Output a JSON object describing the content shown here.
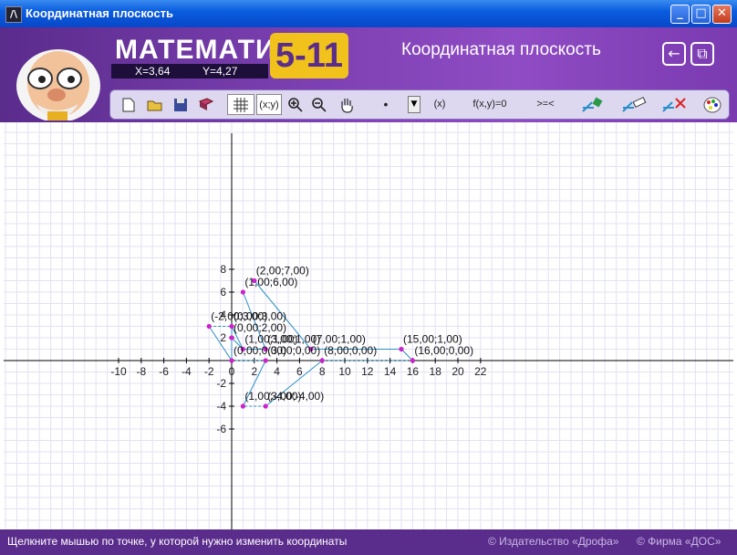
{
  "window": {
    "title": "Координатная плоскость",
    "app_icon_glyph": "/\\",
    "minimize_glyph": "_",
    "maximize_glyph": "□",
    "close_glyph": "✕"
  },
  "header": {
    "brand_word": "МАТЕМАТИКА",
    "brand_grade": "5-11",
    "cursor_x": "X=3,64",
    "cursor_y": "Y=4,27",
    "module_title": "Координатная плоскость",
    "back_glyph": "←",
    "window_glyph": "⧉"
  },
  "toolbar": {
    "point_mode_label": "(x;y)",
    "function_label": "f(x,y)=0",
    "inequality_label": ">=<",
    "dropdown_value": "•",
    "dropdown_arrow": "▼",
    "coord_input_label": "(x)"
  },
  "status": {
    "hint": "Щелкните мышью по точке, у которой нужно изменить координаты",
    "publisher": "© Издательство «Дрофа»",
    "developer": "© Фирма «ДОС»"
  },
  "colors": {
    "accent": "#5a2c8c",
    "point": "#cc22cc",
    "segment": "#2a8fc8",
    "grid": "#e3e1f3",
    "axis": "#000000"
  },
  "chart_data": {
    "type": "scatter",
    "x_range": [
      -10,
      22
    ],
    "y_range": [
      -7,
      9
    ],
    "x_ticks": [
      "-10",
      "-8",
      "-6",
      "-4",
      "-2",
      "0",
      "2",
      "4",
      "6",
      "8",
      "10",
      "12",
      "14",
      "16",
      "18",
      "20",
      "22"
    ],
    "y_ticks": [
      "-6",
      "-4",
      "-2",
      "2",
      "4",
      "6",
      "8"
    ],
    "grid": true,
    "points": [
      {
        "x": 2,
        "y": 7,
        "label": "(2,00;7,00)"
      },
      {
        "x": 1,
        "y": 6,
        "label": "(1,00;6,00)"
      },
      {
        "x": -2,
        "y": 3,
        "label": "(-2,00;3,00)"
      },
      {
        "x": 0,
        "y": 3,
        "label": "(0,00;3,00)"
      },
      {
        "x": 0,
        "y": 2,
        "label": "(0,00;2,00)"
      },
      {
        "x": 1,
        "y": 1,
        "label": "(1,00;1,00)"
      },
      {
        "x": 3,
        "y": 1,
        "label": "(3,00;1,00)"
      },
      {
        "x": 7,
        "y": 1,
        "label": "(7,00;1,00)"
      },
      {
        "x": 15,
        "y": 1,
        "label": "(15,00;1,00)"
      },
      {
        "x": 0,
        "y": 0,
        "label": "(0,00;0,00)"
      },
      {
        "x": 3,
        "y": 0,
        "label": "(3,00;0,00)"
      },
      {
        "x": 8,
        "y": 0,
        "label": "(8,00;0,00)"
      },
      {
        "x": 16,
        "y": 0,
        "label": "(16,00;0,00)"
      },
      {
        "x": 1,
        "y": -4,
        "label": "(1,00;-4,00)"
      },
      {
        "x": 3,
        "y": -4,
        "label": "(3,00;-4,00)"
      }
    ],
    "segments": [
      {
        "from": [
          2,
          7
        ],
        "to": [
          7,
          1
        ],
        "dashed": false
      },
      {
        "from": [
          7,
          1
        ],
        "to": [
          15,
          1
        ],
        "dashed": false
      },
      {
        "from": [
          15,
          1
        ],
        "to": [
          16,
          0
        ],
        "dashed": false
      },
      {
        "from": [
          16,
          0
        ],
        "to": [
          8,
          0
        ],
        "dashed": true
      },
      {
        "from": [
          8,
          0
        ],
        "to": [
          3,
          -4
        ],
        "dashed": false
      },
      {
        "from": [
          3,
          -4
        ],
        "to": [
          1,
          -4
        ],
        "dashed": true
      },
      {
        "from": [
          1,
          -4
        ],
        "to": [
          3,
          0
        ],
        "dashed": false
      },
      {
        "from": [
          3,
          0
        ],
        "to": [
          0,
          0
        ],
        "dashed": true
      },
      {
        "from": [
          0,
          0
        ],
        "to": [
          -2,
          3
        ],
        "dashed": false
      },
      {
        "from": [
          -2,
          3
        ],
        "to": [
          0,
          3
        ],
        "dashed": true
      },
      {
        "from": [
          0,
          3
        ],
        "to": [
          1,
          1
        ],
        "dashed": false
      },
      {
        "from": [
          0,
          2
        ],
        "to": [
          1,
          1
        ],
        "dashed": false
      },
      {
        "from": [
          1,
          1
        ],
        "to": [
          3,
          1
        ],
        "dashed": false
      },
      {
        "from": [
          3,
          1
        ],
        "to": [
          1,
          6
        ],
        "dashed": false
      },
      {
        "from": [
          0,
          0
        ],
        "to": [
          0,
          3
        ],
        "dashed": false
      }
    ]
  }
}
